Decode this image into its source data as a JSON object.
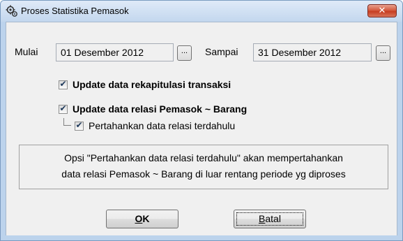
{
  "window": {
    "title": "Proses Statistika Pemasok",
    "close_glyph": "✕",
    "app_icon": "gear-icon"
  },
  "period": {
    "start_label": "Mulai",
    "start_value": "01 Desember 2012",
    "end_label": "Sampai",
    "end_value": "31 Desember 2012",
    "browse_label": "..."
  },
  "options": {
    "rekap": {
      "label": "Update data rekapitulasi transaksi",
      "checked": true
    },
    "relasi": {
      "label": "Update data relasi Pemasok ~ Barang",
      "checked": true
    },
    "pertahankan": {
      "label": "Pertahankan data relasi terdahulu",
      "checked": true
    },
    "check_glyph": "✔"
  },
  "note": {
    "line1": "Opsi \"Pertahankan data relasi terdahulu\" akan mempertahankan",
    "line2": "data relasi Pemasok ~ Barang di luar rentang periode yg diproses"
  },
  "buttons": {
    "ok_mnemonic": "O",
    "ok_rest": "K",
    "cancel_mnemonic": "B",
    "cancel_rest": "atal"
  },
  "colors": {
    "frame": "#bcd3ec",
    "client": "#f0f0f0",
    "close": "#c63d21"
  }
}
